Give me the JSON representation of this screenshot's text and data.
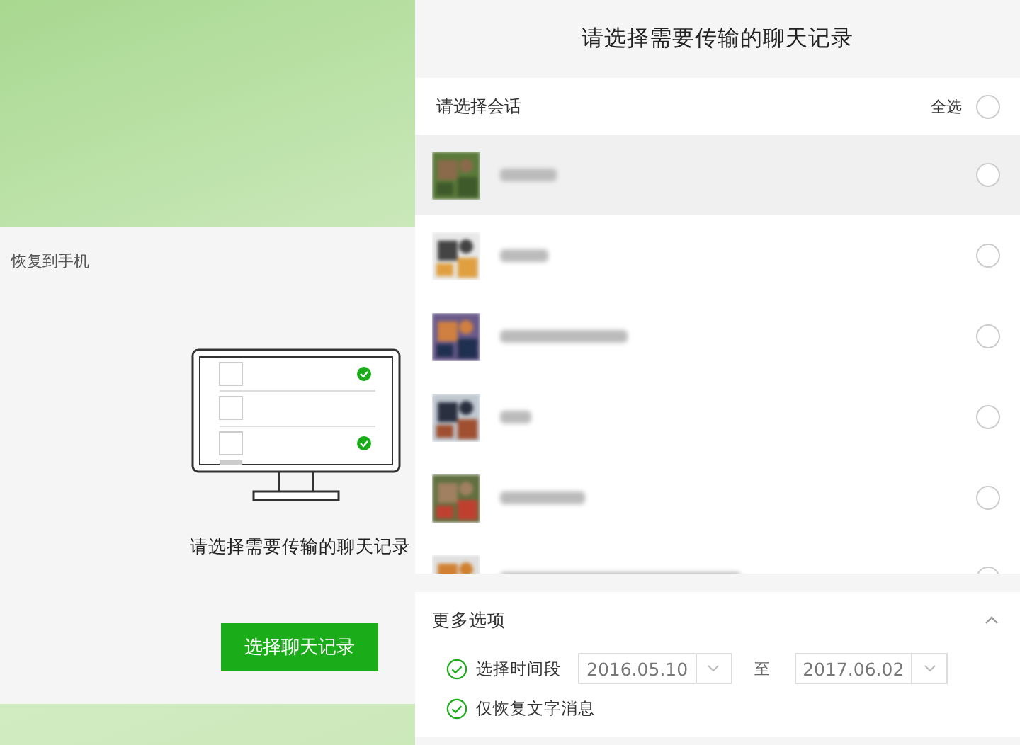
{
  "left_card": {
    "label": "恢复到手机",
    "caption": "请选择需要传输的聊天记录",
    "button": "选择聊天记录"
  },
  "panel": {
    "title": "请选择需要传输的聊天记录",
    "list_header": "请选择会话",
    "select_all": {
      "label": "全选",
      "selected": false
    },
    "conversations": [
      {
        "kind": "picture",
        "hovered": true,
        "selected": false
      },
      {
        "kind": "picture",
        "hovered": false,
        "selected": false
      },
      {
        "kind": "picture",
        "hovered": false,
        "selected": false
      },
      {
        "kind": "picture",
        "hovered": false,
        "selected": false
      },
      {
        "kind": "picture",
        "hovered": false,
        "selected": false
      },
      {
        "kind": "picture",
        "hovered": false,
        "selected": false
      }
    ],
    "more_options": {
      "title": "更多选项",
      "expanded": true,
      "time_range": {
        "label": "选择时间段",
        "checked": true,
        "from": "2016.05.10",
        "separator": "至",
        "to": "2017.06.02"
      },
      "text_only": {
        "label": "仅恢复文字消息",
        "checked": true
      }
    }
  }
}
